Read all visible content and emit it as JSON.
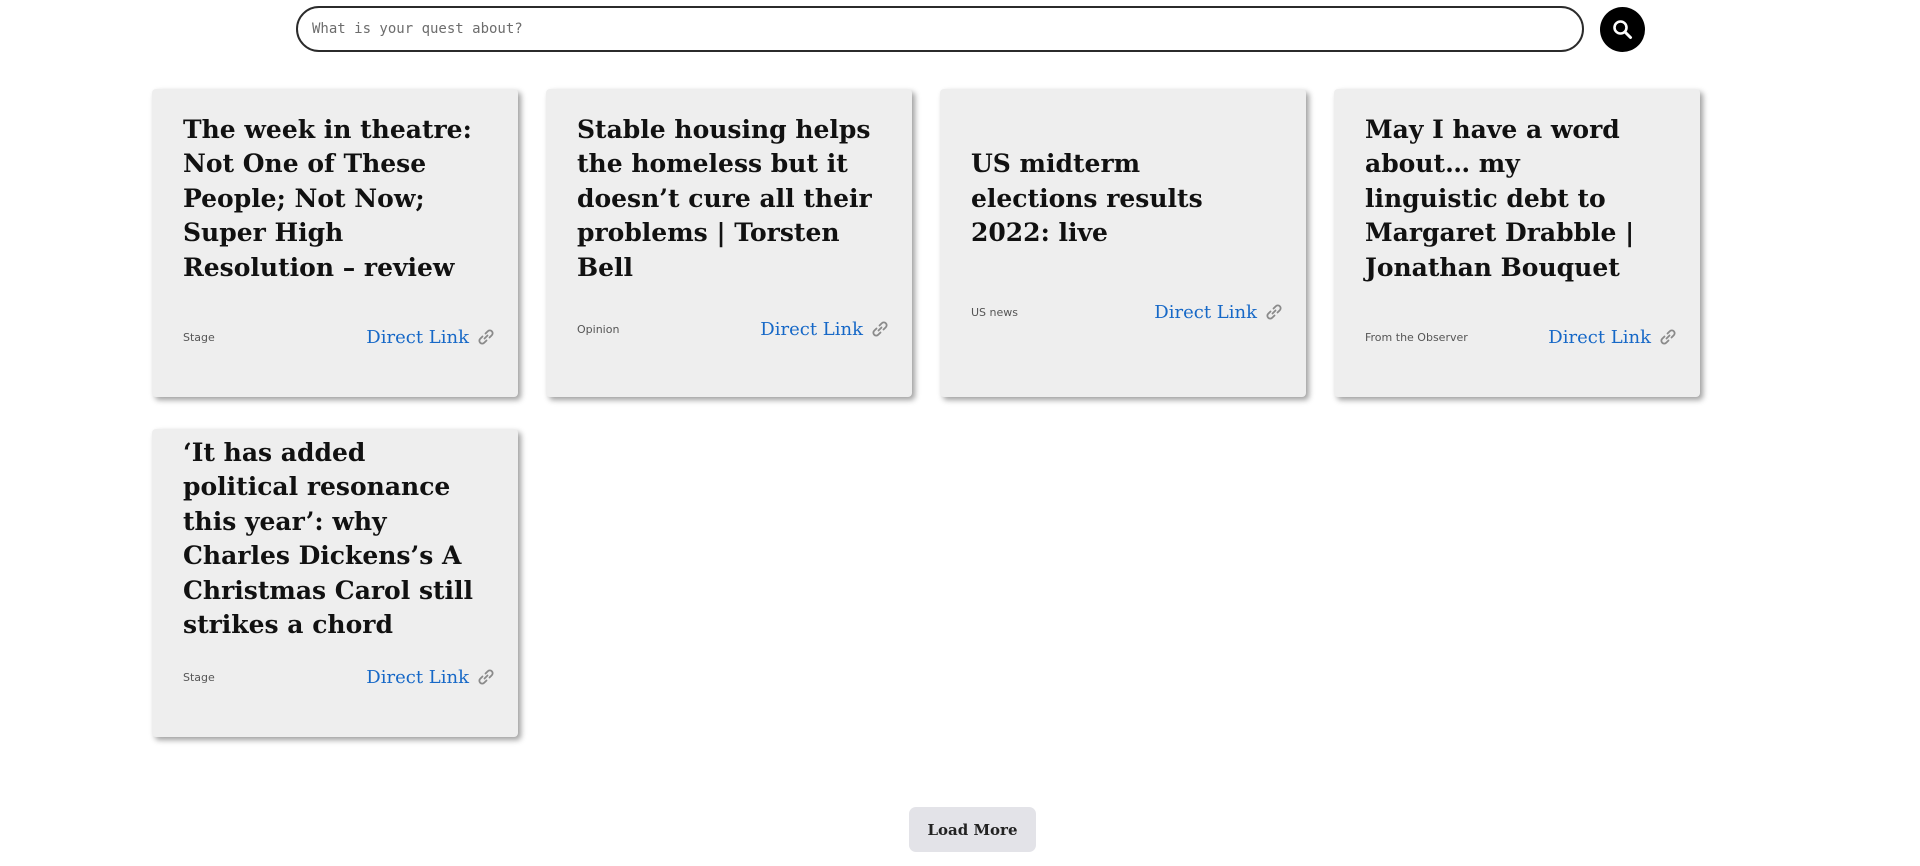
{
  "search": {
    "placeholder": "What is your quest about?",
    "value": ""
  },
  "icons": {
    "search_button": "search-icon",
    "card_link": "link-chain-icon"
  },
  "colors": {
    "link": "#1668c7",
    "card_background": "#eeeeee",
    "search_button": "#000000",
    "load_more_background": "#e3e3e8"
  },
  "cards": [
    {
      "title": "The week in theatre: Not One of These People; Not Now; Super High Resolution – review",
      "category": "Stage",
      "link_label": "Direct Link"
    },
    {
      "title": "Stable housing helps the homeless but it doesn’t cure all their problems | Torsten Bell",
      "category": "Opinion",
      "link_label": "Direct Link"
    },
    {
      "title": "US midterm elections results 2022: live",
      "category": "US news",
      "link_label": "Direct Link"
    },
    {
      "title": "May I have a word about… my linguistic debt to Margaret Drabble | Jonathan Bouquet",
      "category": "From the Observer",
      "link_label": "Direct Link"
    },
    {
      "title": "‘It has added political resonance this year’: why Charles Dickens’s A Christmas Carol still strikes a chord",
      "category": "Stage",
      "link_label": "Direct Link"
    }
  ],
  "load_more": {
    "label": "Load More"
  }
}
